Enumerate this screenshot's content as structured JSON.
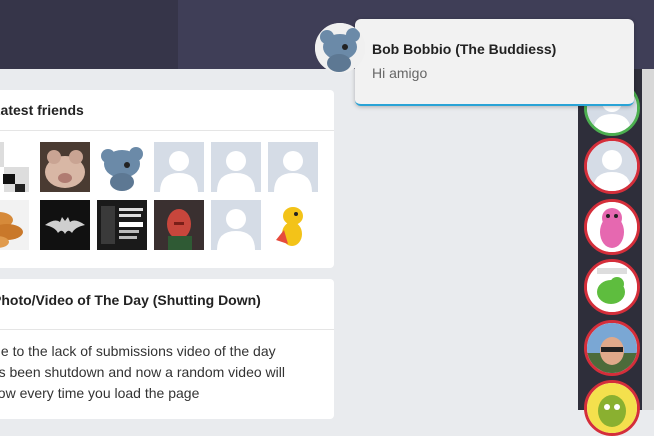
{
  "friends": {
    "title": "Latest friends",
    "items": [
      {
        "kind": "pixel"
      },
      {
        "kind": "pig"
      },
      {
        "kind": "rat"
      },
      {
        "kind": "default"
      },
      {
        "kind": "default"
      },
      {
        "kind": "default"
      },
      {
        "kind": "food"
      },
      {
        "kind": "batman"
      },
      {
        "kind": "poster"
      },
      {
        "kind": "vision"
      },
      {
        "kind": "default"
      },
      {
        "kind": "dino"
      }
    ]
  },
  "potd": {
    "title": "Photo/Video of The Day (Shutting Down)",
    "line1": "Due to the lack of submissions video of the day",
    "line2": "has been shutdown and now a random video will",
    "line3": "show every time you load the page"
  },
  "notification": {
    "name": "Bob Bobbio (The Buddiess)",
    "message": "Hi amigo"
  },
  "sidebar_avatars": [
    {
      "status": "online"
    },
    {
      "status": "offline"
    },
    {
      "status": "offline"
    },
    {
      "status": "offline"
    },
    {
      "status": "offline"
    },
    {
      "status": "offline"
    }
  ],
  "colors": {
    "online": "#4caf50",
    "offline": "#d42e3a",
    "accent": "#29a3d6",
    "topbar": "#3f3e57"
  }
}
